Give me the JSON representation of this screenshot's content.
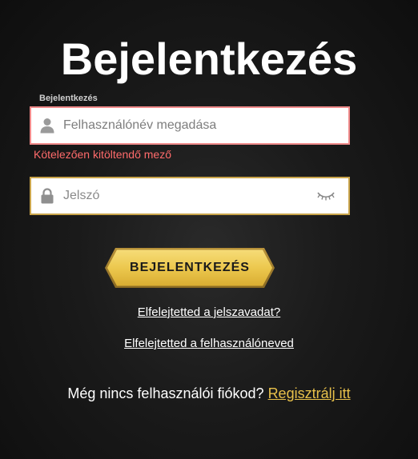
{
  "page": {
    "title": "Bejelentkezés"
  },
  "form": {
    "username_label": "Bejelentkezés",
    "username_placeholder": "Felhasználónév megadása",
    "username_error": "Kötelezően kitöltendő mező",
    "password_placeholder": "Jelszó",
    "submit_label": "BEJELENTKEZÉS"
  },
  "links": {
    "forgot_password": "Elfelejtetted a jelszavadat?",
    "forgot_username": "Elfelejtetted a felhasználóneved"
  },
  "register": {
    "prompt": "Még nincs felhasználói fiókod?",
    "link_label": "Regisztrálj itt"
  },
  "colors": {
    "background": "#1a1a1a",
    "error": "#ff6b6b",
    "accent_gold": "#e8c04a",
    "input_error_border": "#f08a8a",
    "input_border": "#c9a44a"
  },
  "icons": {
    "username": "user-icon",
    "password": "lock-icon",
    "toggle": "eye-closed-icon"
  }
}
